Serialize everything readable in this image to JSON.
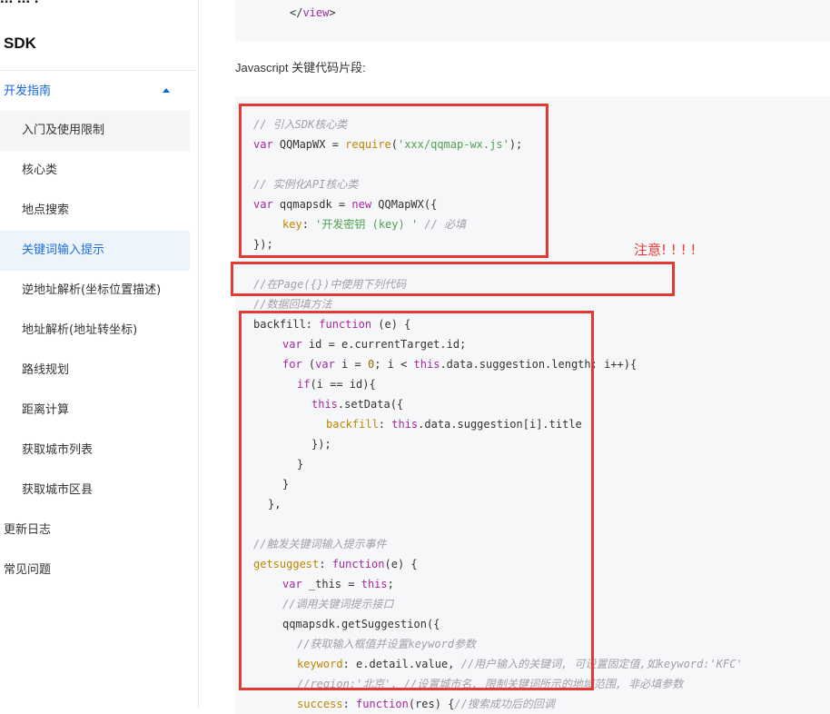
{
  "sidebar": {
    "top_cut_text": "...     ...        .",
    "title": "SDK",
    "section_dev": "开发指南",
    "items": [
      "入门及使用限制",
      "核心类",
      "地点搜索",
      "关键词输入提示",
      "逆地址解析(坐标位置描述)",
      "地址解析(地址转坐标)",
      "路线规划",
      "距离计算",
      "获取城市列表",
      "获取城市区县"
    ],
    "section_changelog": "更新日志",
    "section_faq": "常见问题"
  },
  "main": {
    "view_close_open": "</",
    "view_close_tag": "view",
    "view_close_end": ">",
    "js_label": "Javascript 关键代码片段:",
    "annotation": "注意! ! ! !",
    "code": {
      "l1": "// 引入SDK核心类",
      "l2_var": "var",
      "l2_mid": " QQMapWX = ",
      "l2_req": "require",
      "l2_paren": "(",
      "l2_str": "'xxx/qqmap-wx.js'",
      "l2_end": ");",
      "l3": "// 实例化API核心类",
      "l4_var": "var",
      "l4_mid": " qqmapsdk = ",
      "l4_new": "new",
      "l4_end": " QQMapWX({",
      "l5_key": "key",
      "l5_colon": ": ",
      "l5_str": "'开发密钥 (key) '",
      "l5_cmt": " // 必填",
      "l6": "});",
      "l7": "//在Page({})中使用下列代码",
      "l8": "//数据回填方法",
      "l9_name": "backfill",
      "l9_colon": ": ",
      "l9_fn": "function",
      "l9_end": " (e) {",
      "l10_var": "var",
      "l10_end": " id = e.currentTarget.id;",
      "l11_for": "for",
      "l11_a": " (",
      "l11_var": "var",
      "l11_b": " i = ",
      "l11_zero": "0",
      "l11_c": "; i < ",
      "l11_this": "this",
      "l11_d": ".data.suggestion.length; i++){",
      "l12_if": "if",
      "l12_end": "(i == id){",
      "l13_this": "this",
      "l13_end": ".setData({",
      "l14_key": "backfill",
      "l14_colon": ": ",
      "l14_this": "this",
      "l14_end": ".data.suggestion[i].title",
      "l15": "});",
      "l16": "}",
      "l17": "}",
      "l18": "},",
      "l19": "//触发关键词输入提示事件",
      "l20_name": "getsuggest",
      "l20_colon": ": ",
      "l20_fn": "function",
      "l20_end": "(e) {",
      "l21_var": "var",
      "l21_mid": " _this = ",
      "l21_this": "this",
      "l21_end": ";",
      "l22": "//调用关键词提示接口",
      "l23": "qqmapsdk.getSuggestion({",
      "l24": "//获取输入框值并设置keyword参数",
      "l25_key": "keyword",
      "l25_mid": ": e.detail.value, ",
      "l25_cmt": "//用户输入的关键词, 可设置固定值,如keyword:'KFC'",
      "l26": "//region:'北京', //设置城市名, 限制关键词所示的地域范围, 非必填参数",
      "l27_key": "success",
      "l27_colon": ": ",
      "l27_fn": "function",
      "l27_mid": "(res) {",
      "l27_cmt": "//搜索成功后的回调"
    }
  },
  "colors": {
    "accent": "#1565d8",
    "highlight_box": "#e53935",
    "code_bg": "#f6f7f8"
  }
}
